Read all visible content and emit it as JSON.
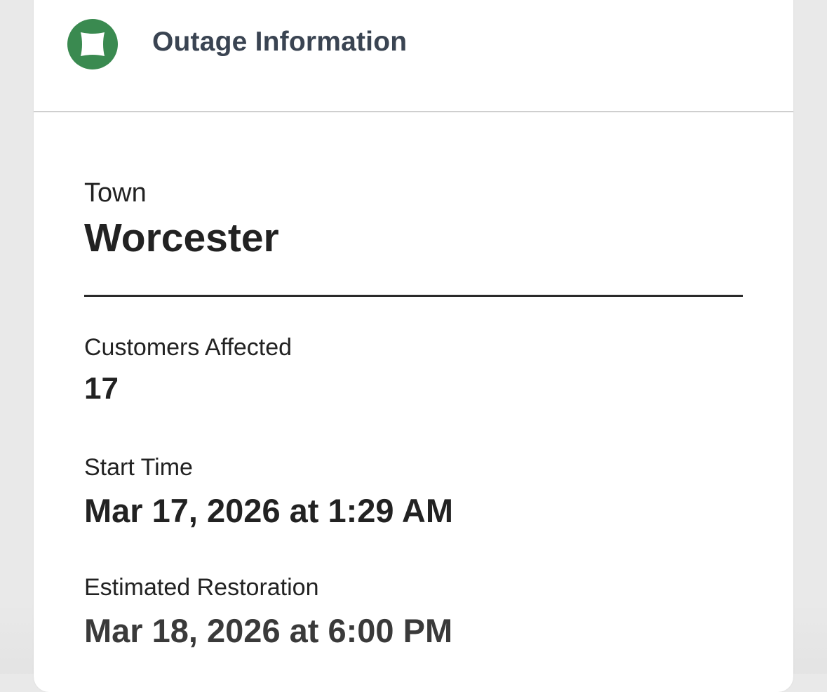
{
  "header": {
    "status_icon": "outage-status-icon",
    "status_color": "#3a8a50",
    "title": "Outage Information"
  },
  "fields": {
    "town": {
      "label": "Town",
      "value": "Worcester"
    },
    "customers_affected": {
      "label": "Customers Affected",
      "value": "17"
    },
    "start_time": {
      "label": "Start Time",
      "value": "Mar 17, 2026 at 1:29 AM"
    },
    "estimated_restoration": {
      "label": "Estimated Restoration",
      "value": "Mar 18, 2026 at 6:00 PM"
    }
  }
}
